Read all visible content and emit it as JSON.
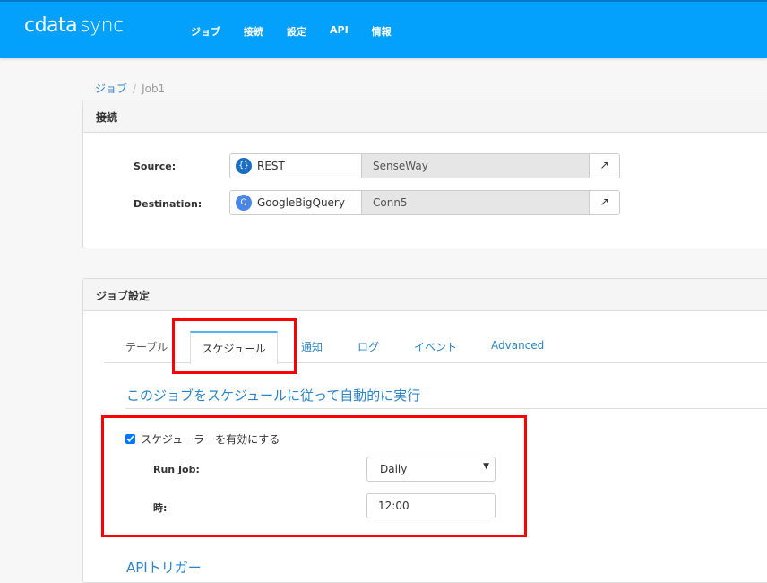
{
  "header": {
    "logo_main": "cdata",
    "logo_sub": "sync",
    "nav": [
      "ジョブ",
      "接続",
      "設定",
      "API",
      "情報"
    ]
  },
  "breadcrumb": {
    "parent": "ジョブ",
    "separator": "/",
    "current": "Job1"
  },
  "connections": {
    "title": "接続",
    "source": {
      "label": "Source:",
      "provider": "REST",
      "connection": "SenseWay"
    },
    "destination": {
      "label": "Destination:",
      "provider": "GoogleBigQuery",
      "connection": "Conn5"
    }
  },
  "job_settings": {
    "title": "ジョブ設定",
    "tabs": [
      "テーブル",
      "スケジュール",
      "通知",
      "ログ",
      "イベント",
      "Advanced"
    ],
    "active_tab": "スケジュール",
    "schedule_heading": "このジョブをスケジュールに従って自動的に実行",
    "enable_label": "スケジューラーを有効にする",
    "enabled": true,
    "run_job_label": "Run Job:",
    "run_job_value": "Daily",
    "time_label": "時:",
    "time_value": "12:00",
    "api_trigger_heading": "APIトリガー"
  },
  "colors": {
    "brand": "#03a1fb",
    "link": "#2a84c6",
    "highlight": "#ff0000"
  }
}
